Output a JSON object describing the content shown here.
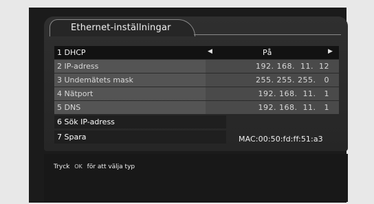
{
  "title": "Ethernet-inställningar",
  "menu": [
    {
      "label": "1 DHCP",
      "value": "På"
    },
    {
      "label": "2 IP-adress",
      "value": "192. 168.  11.  12"
    },
    {
      "label": "3 Undemätets mask",
      "value": "255. 255. 255.   0"
    },
    {
      "label": "4 Nätport",
      "value": "192. 168.  11.   1"
    },
    {
      "label": "5 DNS",
      "value": "192. 168.  11.   1"
    },
    {
      "label": "6 Sök IP-adress"
    },
    {
      "label": "7 Spara"
    }
  ],
  "mac": "MAC:00:50:fd:ff:51:a3",
  "help": {
    "prefix": "Tryck",
    "key": "OK",
    "suffix": "för att välja typ"
  },
  "colors": {
    "background": "#1b1b1b",
    "row_grey": "#545454",
    "row_selected": "#121212"
  },
  "icons": {
    "left": "arrow-left-icon",
    "right": "arrow-right-icon"
  }
}
